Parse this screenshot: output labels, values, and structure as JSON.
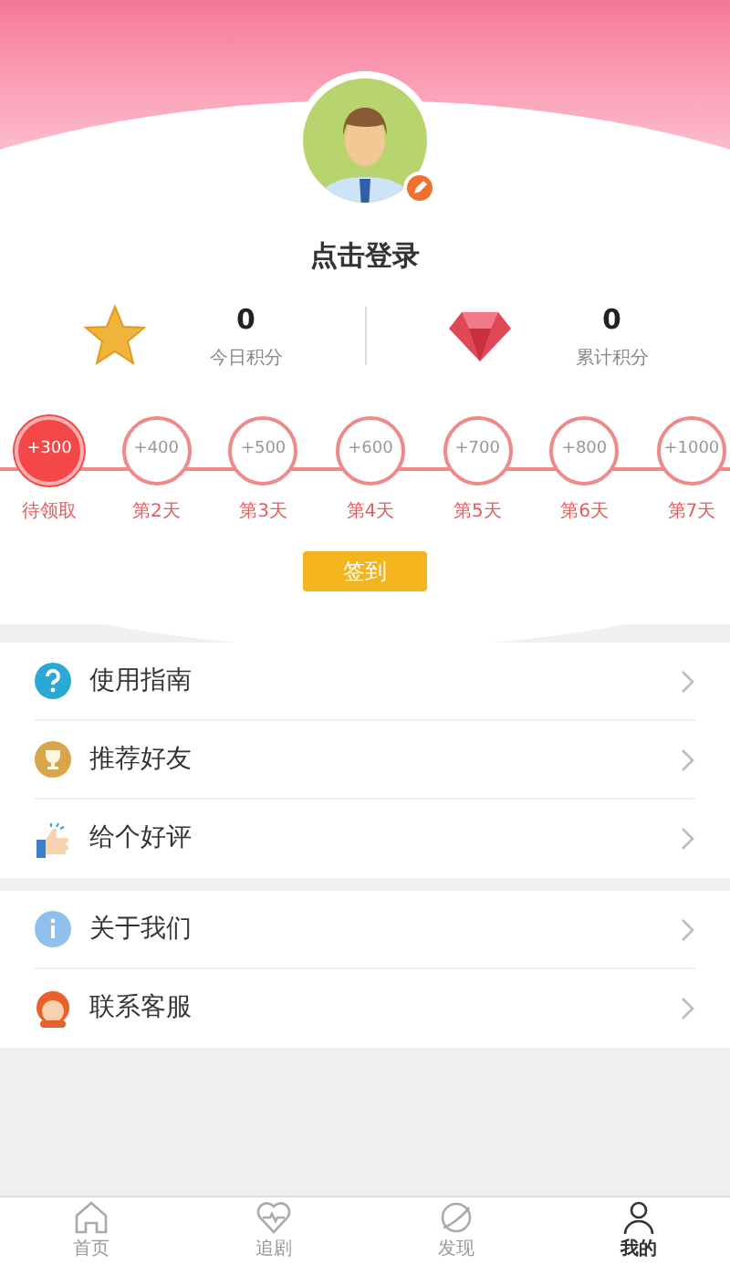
{
  "profile": {
    "login_label": "点击登录"
  },
  "stats": [
    {
      "kind": "star",
      "value": "0",
      "label": "今日积分"
    },
    {
      "kind": "gem",
      "value": "0",
      "label": "累计积分"
    }
  ],
  "checkin_days": [
    {
      "points": "+300",
      "label": "待领取",
      "selected": true
    },
    {
      "points": "+400",
      "label": "第2天",
      "selected": false
    },
    {
      "points": "+500",
      "label": "第3天",
      "selected": false
    },
    {
      "points": "+600",
      "label": "第4天",
      "selected": false
    },
    {
      "points": "+700",
      "label": "第5天",
      "selected": false
    },
    {
      "points": "+800",
      "label": "第6天",
      "selected": false
    },
    {
      "points": "+1000",
      "label": "第7天",
      "selected": false
    }
  ],
  "checkin_button": "签到",
  "menu_groups": [
    [
      {
        "kind": "guide",
        "label": "使用指南"
      },
      {
        "kind": "recommend",
        "label": "推荐好友"
      },
      {
        "kind": "review",
        "label": "给个好评"
      }
    ],
    [
      {
        "kind": "about",
        "label": "关于我们"
      },
      {
        "kind": "service",
        "label": "联系客服"
      }
    ]
  ],
  "tab_bar": [
    {
      "kind": "home",
      "label": "首页",
      "selected": false
    },
    {
      "kind": "follow",
      "label": "追剧",
      "selected": false
    },
    {
      "kind": "discover",
      "label": "发现",
      "selected": false
    },
    {
      "kind": "mine",
      "label": "我的",
      "selected": true
    }
  ]
}
